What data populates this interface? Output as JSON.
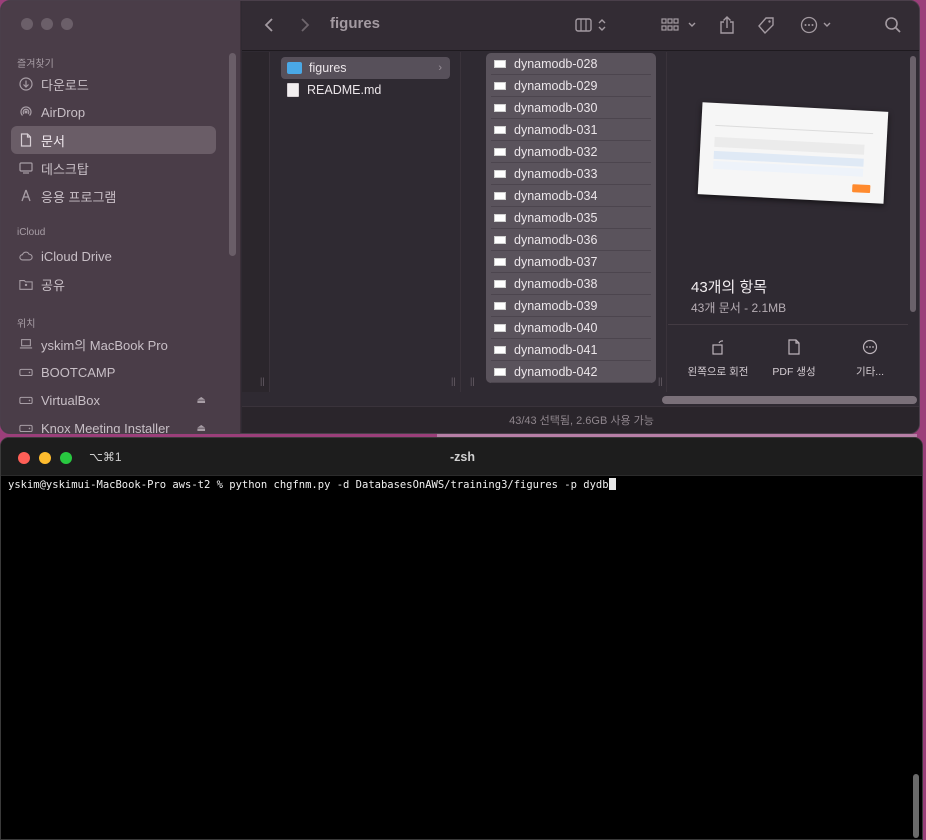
{
  "finder": {
    "title": "figures",
    "sidebar": {
      "sections": [
        {
          "label": "즐겨찾기",
          "items": [
            {
              "label": "다운로드",
              "icon": "download-icon"
            },
            {
              "label": "AirDrop",
              "icon": "airdrop-icon"
            },
            {
              "label": "문서",
              "icon": "document-icon",
              "selected": true
            },
            {
              "label": "데스크탑",
              "icon": "desktop-icon"
            },
            {
              "label": "응용 프로그램",
              "icon": "applications-icon"
            }
          ]
        },
        {
          "label": "iCloud",
          "items": [
            {
              "label": "iCloud Drive",
              "icon": "cloud-icon"
            },
            {
              "label": "공유",
              "icon": "shared-folder-icon"
            }
          ]
        },
        {
          "label": "위치",
          "items": [
            {
              "label": "yskim의 MacBook Pro",
              "icon": "laptop-icon"
            },
            {
              "label": "BOOTCAMP",
              "icon": "disk-icon"
            },
            {
              "label": "VirtualBox",
              "icon": "disk-icon",
              "eject": true
            },
            {
              "label": "Knox Meeting Installer",
              "icon": "disk-icon",
              "eject": true
            }
          ]
        }
      ]
    },
    "column2": [
      {
        "label": "figures",
        "type": "folder",
        "selected": true
      },
      {
        "label": "README.md",
        "type": "file"
      }
    ],
    "column3": [
      "dynamodb-028",
      "dynamodb-029",
      "dynamodb-030",
      "dynamodb-031",
      "dynamodb-032",
      "dynamodb-033",
      "dynamodb-034",
      "dynamodb-035",
      "dynamodb-036",
      "dynamodb-037",
      "dynamodb-038",
      "dynamodb-039",
      "dynamodb-040",
      "dynamodb-041",
      "dynamodb-042"
    ],
    "preview": {
      "title": "43개의 항목",
      "subtitle": "43개 문서 - 2.1MB",
      "actions": [
        {
          "label": "왼쪽으로 회전",
          "icon": "rotate-left-icon"
        },
        {
          "label": "PDF 생성",
          "icon": "pdf-icon"
        },
        {
          "label": "기타...",
          "icon": "more-icon"
        }
      ]
    },
    "status": "43/43 선택됨, 2.6GB 사용 가능"
  },
  "terminal": {
    "shortcut": "⌥⌘1",
    "title": "-zsh",
    "line": "yskim@yskimui-MacBook-Pro aws-t2 % python chgfnm.py -d DatabasesOnAWS/training3/figures -p dydb"
  }
}
